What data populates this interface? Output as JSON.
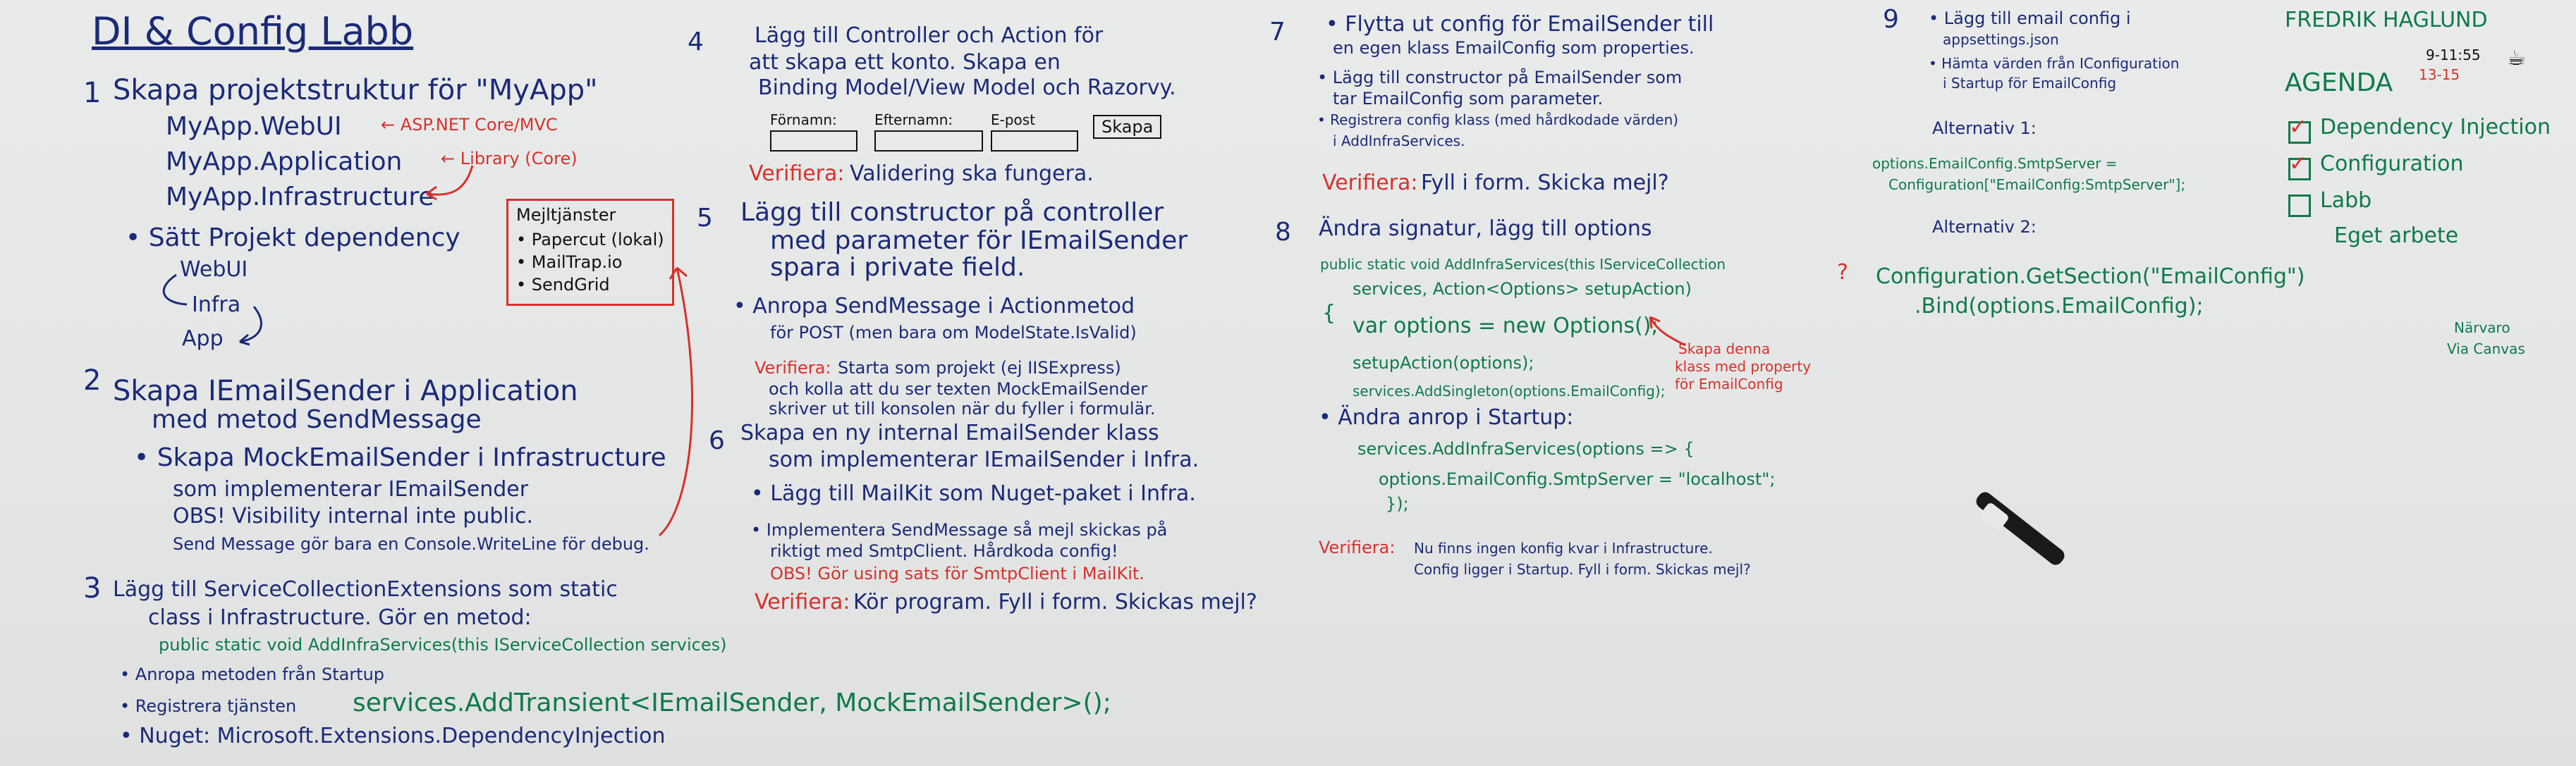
{
  "title": "DI & Config Labb",
  "sec1": {
    "num": "1",
    "heading": "Skapa projektstruktur för \"MyApp\"",
    "projects": [
      "MyApp.WebUI",
      "MyApp.Application",
      "MyApp.Infrastructure"
    ],
    "notes": [
      "ASP.NET Core/MVC",
      "Library (Core)"
    ],
    "dep": "Sätt Projekt dependency",
    "chain": [
      "WebUI",
      "Infra",
      "App"
    ]
  },
  "mailbox": {
    "title": "Mejltjänster",
    "items": [
      "Papercut (lokal)",
      "MailTrap.io",
      "SendGrid"
    ]
  },
  "sec2": {
    "num": "2",
    "l1": "Skapa IEmailSender i Application",
    "l2": "med metod SendMessage",
    "l3": "Skapa MockEmailSender i Infrastructure",
    "l4": "som implementerar IEmailSender",
    "l5": "OBS! Visibility internal inte public.",
    "l6": "Send Message gör bara en Console.WriteLine för debug."
  },
  "sec3": {
    "num": "3",
    "l1": "Lägg till ServiceCollectionExtensions som static",
    "l2": "class i Infrastructure. Gör en metod:",
    "l3": "public static void AddInfraServices(this IServiceCollection services)",
    "l4": "Anropa metoden från Startup",
    "l5a": "Registrera tjänsten",
    "l5b": "services.AddTransient<IEmailSender, MockEmailSender>();",
    "l6": "Nuget: Microsoft.Extensions.DependencyInjection"
  },
  "sec4": {
    "num": "4",
    "l1": "Lägg till Controller och Action för",
    "l2": "att skapa ett konto. Skapa en",
    "l3": "Binding Model/View Model och Razorvy.",
    "form": [
      "Förnamn:",
      "Efternamn:",
      "E-post"
    ],
    "btn": "Skapa",
    "verify_label": "Verifiera:",
    "verify": "Validering ska fungera."
  },
  "sec5": {
    "num": "5",
    "l1": "Lägg till constructor på controller",
    "l2": "med parameter för IEmailSender",
    "l3": "spara i private field.",
    "l4": "Anropa SendMessage i Actionmetod",
    "l5": "för POST (men bara om ModelState.IsValid)",
    "verify_label": "Verifiera:",
    "v1": "Starta som projekt (ej IISExpress)",
    "v2": "och kolla att du ser texten MockEmailSender",
    "v3": "skriver ut till konsolen när du fyller i formulär."
  },
  "sec6": {
    "num": "6",
    "l1": "Skapa en ny internal EmailSender klass",
    "l2": "som implementerar IEmailSender i Infra.",
    "l3": "Lägg till MailKit som Nuget-paket i Infra.",
    "l4": "Implementera SendMessage så mejl skickas på",
    "l5": "riktigt med SmtpClient. Hårdkoda config!",
    "l6": "OBS! Gör using sats för SmtpClient i MailKit.",
    "verify_label": "Verifiera:",
    "verify": "Kör program. Fyll i form. Skickas mejl?"
  },
  "sec7": {
    "num": "7",
    "l1": "Flytta ut config för EmailSender till",
    "l2": "en egen klass EmailConfig som properties.",
    "l3": "Lägg till constructor på EmailSender som",
    "l4": "tar EmailConfig som parameter.",
    "l5": "Registrera config klass (med hårdkodade värden)",
    "l6": "i AddInfraServices.",
    "verify_label": "Verifiera:",
    "verify": "Fyll i form. Skicka mejl?"
  },
  "sec8": {
    "num": "8",
    "l1": "Ändra signatur, lägg till options",
    "c1": "public static void AddInfraServices(this IServiceCollection",
    "c2": "services, Action<Options> setupAction)",
    "c3": "{",
    "c4": "var options = new Options();",
    "c5": "setupAction(options);",
    "c6": "services.AddSingleton(options.EmailConfig);",
    "note": [
      "Skapa denna",
      "klass med property",
      "för EmailConfig"
    ],
    "l2": "Ändra anrop i Startup:",
    "c7": "services.AddInfraServices(options => {",
    "c8": "options.EmailConfig.SmtpServer = \"localhost\";",
    "c9": "});",
    "verify_label": "Verifiera:",
    "v1": "Nu finns ingen konfig kvar i Infrastructure.",
    "v2": "Config ligger i Startup. Fyll i form. Skickas mejl?"
  },
  "sec9": {
    "num": "9",
    "l1": "Lägg till email config i",
    "l2": "appsettings.json",
    "l3": "Hämta värden från IConfiguration",
    "l4": "i Startup för EmailConfig",
    "alt1": "Alternativ 1:",
    "a1a": "options.EmailConfig.SmtpServer =",
    "a1b": "Configuration[\"EmailConfig:SmtpServer\"];",
    "alt2": "Alternativ 2:",
    "a2a": "Configuration.GetSection(\"EmailConfig\")",
    "a2b": ".Bind(options.EmailConfig);"
  },
  "agenda": {
    "author": "FREDRIK HAGLUND",
    "title": "AGENDA",
    "times": [
      "9-11:55",
      "13-15"
    ],
    "items": [
      "Dependency Injection",
      "Configuration",
      "Labb",
      "Eget arbete"
    ],
    "note": [
      "Närvaro",
      "Via Canvas"
    ]
  }
}
